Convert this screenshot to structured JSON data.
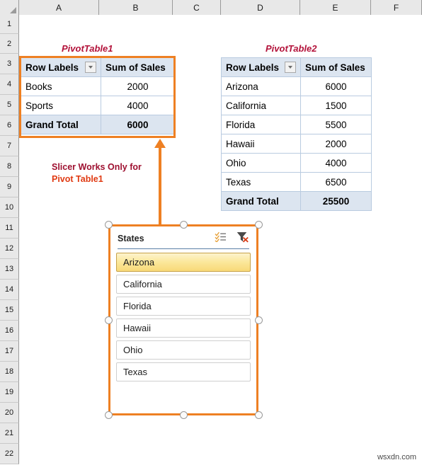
{
  "spreadsheet": {
    "column_headers": [
      "A",
      "B",
      "C",
      "D",
      "E",
      "F"
    ],
    "row_headers": [
      "1",
      "2",
      "3",
      "4",
      "5",
      "6",
      "7",
      "8",
      "9",
      "10",
      "11",
      "12",
      "13",
      "14",
      "15",
      "16",
      "17",
      "18",
      "19",
      "20",
      "21",
      "22"
    ]
  },
  "pivot_table_1": {
    "title": "PivotTable1",
    "headers": [
      "Row Labels",
      "Sum of Sales"
    ],
    "rows": [
      {
        "label": "Books",
        "value": "2000"
      },
      {
        "label": "Sports",
        "value": "4000"
      }
    ],
    "grand_total": {
      "label": "Grand Total",
      "value": "6000"
    }
  },
  "pivot_table_2": {
    "title": "PivotTable2",
    "headers": [
      "Row Labels",
      "Sum of Sales"
    ],
    "rows": [
      {
        "label": "Arizona",
        "value": "6000"
      },
      {
        "label": "California",
        "value": "1500"
      },
      {
        "label": "Florida",
        "value": "5500"
      },
      {
        "label": "Hawaii",
        "value": "2000"
      },
      {
        "label": "Ohio",
        "value": "4000"
      },
      {
        "label": "Texas",
        "value": "6500"
      }
    ],
    "grand_total": {
      "label": "Grand Total",
      "value": "25500"
    }
  },
  "annotation": {
    "line1": "Slicer Works Only for",
    "line2": "Pivot Table1"
  },
  "slicer": {
    "caption": "States",
    "multi_select_icon": "multi-select-icon",
    "clear_filter_icon": "clear-filter-icon",
    "items": [
      {
        "label": "Arizona",
        "selected": true
      },
      {
        "label": "California",
        "selected": false
      },
      {
        "label": "Florida",
        "selected": false
      },
      {
        "label": "Hawaii",
        "selected": false
      },
      {
        "label": "Ohio",
        "selected": false
      },
      {
        "label": "Texas",
        "selected": false
      }
    ]
  },
  "watermark": "wsxdn.com",
  "colors": {
    "accent_orange": "#ee8023",
    "title_red": "#b3123a",
    "annotation_dark_red": "#9e1030",
    "annotation_red": "#e03a12",
    "pivot_header_fill": "#dce5f0",
    "pivot_border": "#b9cbe0",
    "slicer_selected": "#f8d978"
  }
}
